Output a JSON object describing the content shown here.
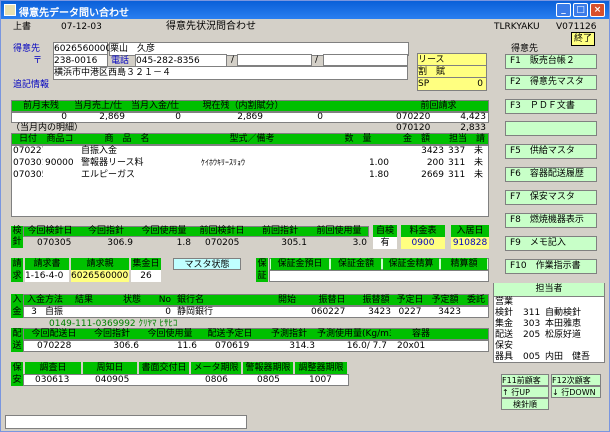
{
  "window": {
    "title": "得意先データ問い合わせ",
    "min": "_",
    "max": "□",
    "close": "×"
  },
  "header": {
    "mode": "上書",
    "date": "07-12-03",
    "screen": "得意先状況問合わせ",
    "program": "TLRKYAKU",
    "version": "V071126",
    "end_button": "終了"
  },
  "customer": {
    "label": "得意先",
    "code": "6026560000",
    "name": "栗山　久彦",
    "zip_label": "〒",
    "zip": "238-0016",
    "tel_label": "電話",
    "tel": "045-282-8356",
    "slash1": "/",
    "slash2": "/",
    "address": "横浜市中港区西島３２１－４",
    "extra_label": "追記情報"
  },
  "flags": {
    "lease": "リース",
    "installment": "割　賦",
    "sp": "SP",
    "sp_val": "0"
  },
  "fkeys": {
    "title": "得意先",
    "f1": "F1　販売台帳２",
    "f2": "F2　得意先マスタ",
    "f3": "F3　ＰＤＦ文書",
    "f4": "",
    "f5": "F5　供給マスタ",
    "f6": "F6　容器配送履歴",
    "f7": "F7　保安マスタ",
    "f8": "F8　燃焼機器表示",
    "f9": "F9　メモ記入",
    "f10": "F10　作業指示書"
  },
  "balance": {
    "headers": [
      "前月末残",
      "当月売上/仕",
      "当月入金/仕",
      "現在残（内割賦分）",
      "",
      "前回請求"
    ],
    "values": [
      "0",
      "2,869",
      "0",
      "2,869",
      "0",
      "070220",
      "4,423",
      "070120",
      "2,833"
    ]
  },
  "detail": {
    "caption": "（当月内の明細）",
    "headers": [
      "日付",
      "商品コ",
      "商　品　名",
      "型式／備考",
      "数　量",
      "金　額",
      "担当",
      "請"
    ],
    "rows": [
      {
        "date": "070227",
        "code": "",
        "name": "自振入金",
        "model": "",
        "qty": "",
        "amount": "3423",
        "staff": "337",
        "st": "未"
      },
      {
        "date": "070301",
        "code": "90000",
        "name": "警報器リース料",
        "model": "ｹｲﾎｳｷﾘｰｽﾘｮｳ",
        "qty": "1.00",
        "amount": "200",
        "staff": "311",
        "st": "未"
      },
      {
        "date": "070305",
        "code": "",
        "name": "エルピーガス",
        "model": "",
        "qty": "1.80",
        "amount": "2669",
        "staff": "311",
        "st": "未"
      }
    ]
  },
  "meter": {
    "side": "検",
    "side2": "針",
    "headers": [
      "今回検針日",
      "今回指針",
      "今回使用量",
      "前回検針日",
      "前回指針",
      "前回使用量",
      "自検",
      "料金表",
      "入居日"
    ],
    "values": [
      "070305",
      "306.9",
      "1.8",
      "070205",
      "305.1",
      "3.0",
      "有",
      "0900",
      "910828"
    ]
  },
  "billing": {
    "side": "請",
    "side2": "求",
    "headers": [
      "請求書",
      "請求親",
      "集金日"
    ],
    "values": [
      "1-16-4-0",
      "6026560000",
      "26"
    ],
    "master_state": "マスタ状態"
  },
  "guarantee": {
    "side": "保",
    "side2": "証",
    "headers": [
      "保証金預日",
      "保証金額",
      "保証金精算",
      "精算額"
    ]
  },
  "payment": {
    "side": "入",
    "side2": "金",
    "headers": [
      "入金方法",
      "結果",
      "状態",
      "No",
      "銀行名",
      "開始",
      "振替日",
      "振替額",
      "予定日",
      "予定額",
      "委託"
    ],
    "values": [
      "3",
      "自振",
      "",
      "0",
      "静岡銀行",
      "",
      "060227",
      "3423",
      "0227",
      "3423",
      ""
    ],
    "account": "0149-111-0369992  ｸﾘﾔﾏ ﾋｻﾋｺ"
  },
  "delivery": {
    "side": "配",
    "side2": "送",
    "headers": [
      "今回配送日",
      "今回指針",
      "今回使用量",
      "配送予定日",
      "予測指針",
      "予測使用量(Kg/m3)",
      "容器"
    ],
    "values": [
      "070228",
      "306.6",
      "11.6",
      "070619",
      "314.3",
      "16.0/ 7.7",
      "20x01"
    ]
  },
  "safety": {
    "side": "保",
    "side2": "安",
    "headers": [
      "調査日",
      "周知日",
      "書面交付日",
      "メータ期限",
      "警報器期限",
      "調整器期限"
    ],
    "values": [
      "030613",
      "040905",
      "",
      "0806",
      "0805",
      "1007"
    ]
  },
  "staff": {
    "title": "担当者",
    "rows": [
      [
        "営業",
        ""
      ],
      [
        "検針",
        "311",
        "自動検針"
      ],
      [
        "集金",
        "303",
        "本田雅恵"
      ],
      [
        "配送",
        "205",
        "松原好道"
      ],
      [
        "保安",
        ""
      ],
      [
        "器具",
        "005",
        "内田　健吾"
      ]
    ]
  },
  "nav": {
    "f11": "F11前顧客",
    "f12": "F12次顧客",
    "up": "↑ 行UP",
    "down": "↓ 行DOWN",
    "order": "検針順"
  },
  "colors": {
    "title": "#2a7ff0",
    "green": "#00c000",
    "yellow": "#ffff80",
    "lightgreen": "#c8ffc8"
  }
}
